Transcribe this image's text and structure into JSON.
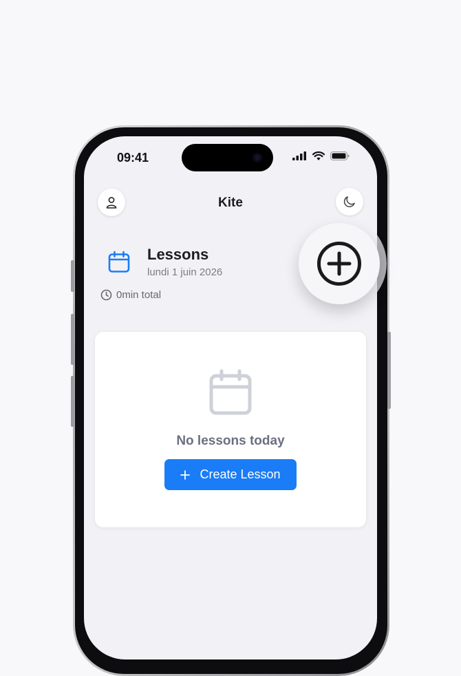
{
  "status_bar": {
    "time": "09:41"
  },
  "nav": {
    "title": "Kite"
  },
  "header": {
    "title": "Lessons",
    "date": "lundi 1 juin 2026",
    "total": "0min total"
  },
  "empty_state": {
    "message": "No lessons today",
    "create_button_label": "Create Lesson",
    "create_button_icon": "plus-icon"
  },
  "colors": {
    "accent": "#1a7cf6",
    "background": "#f2f2f6",
    "card": "#ffffff",
    "muted_text": "#6b7080"
  },
  "icons": {
    "profile": "user-icon",
    "theme": "moon-icon",
    "calendar": "calendar-icon",
    "clock": "clock-icon",
    "add": "plus-circle-icon"
  }
}
